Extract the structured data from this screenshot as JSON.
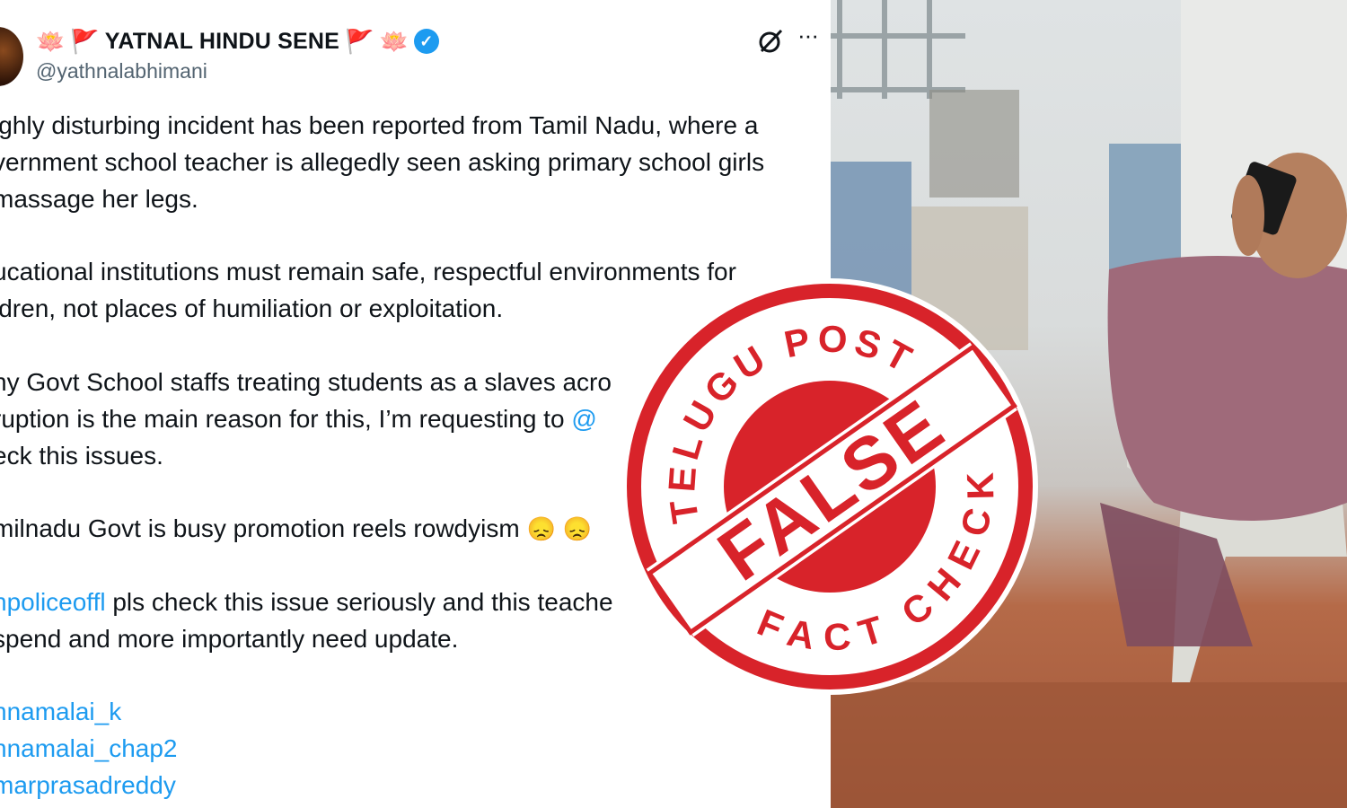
{
  "tweet": {
    "display_name": "YATNAL HINDU SENE",
    "handle": "@yathnalabhimani",
    "name_emoji_left": [
      "🪷",
      "🚩"
    ],
    "name_emoji_right": [
      "🚩",
      "🪷"
    ],
    "verified_mark": "✓",
    "more_label": "···",
    "lines": [
      "ighly disturbing incident has been reported from Tamil Nadu, where a",
      "vernment school teacher is allegedly seen asking primary school girls",
      "massage her legs.",
      "ucational institutions must remain safe, respectful environments for",
      "ldren, not places of humiliation or exploitation.",
      "ny Govt School staffs treating students as a slaves acro",
      "ruption is the main reason for this, I’m requesting to",
      "eck this issues.",
      "milnadu Govt is busy promotion reels rowdyism",
      "pls check this issue seriously and this teache",
      "spend and more importantly need update."
    ],
    "inline_mentions": {
      "requesting_to": "@",
      "police": "npoliceoffl"
    },
    "sad_emoji": [
      "😞",
      "😞"
    ],
    "mentions": [
      "nnamalai_k",
      "nnamalai_chap2",
      "marprasadreddy"
    ]
  },
  "stamp": {
    "top_text": "TELUGU POST",
    "center_text": "FALSE",
    "bottom_text": "FACT CHECK",
    "color": "#d8232a"
  },
  "colors": {
    "text": "#0f1419",
    "secondary": "#536471",
    "link": "#1d9bf0"
  }
}
